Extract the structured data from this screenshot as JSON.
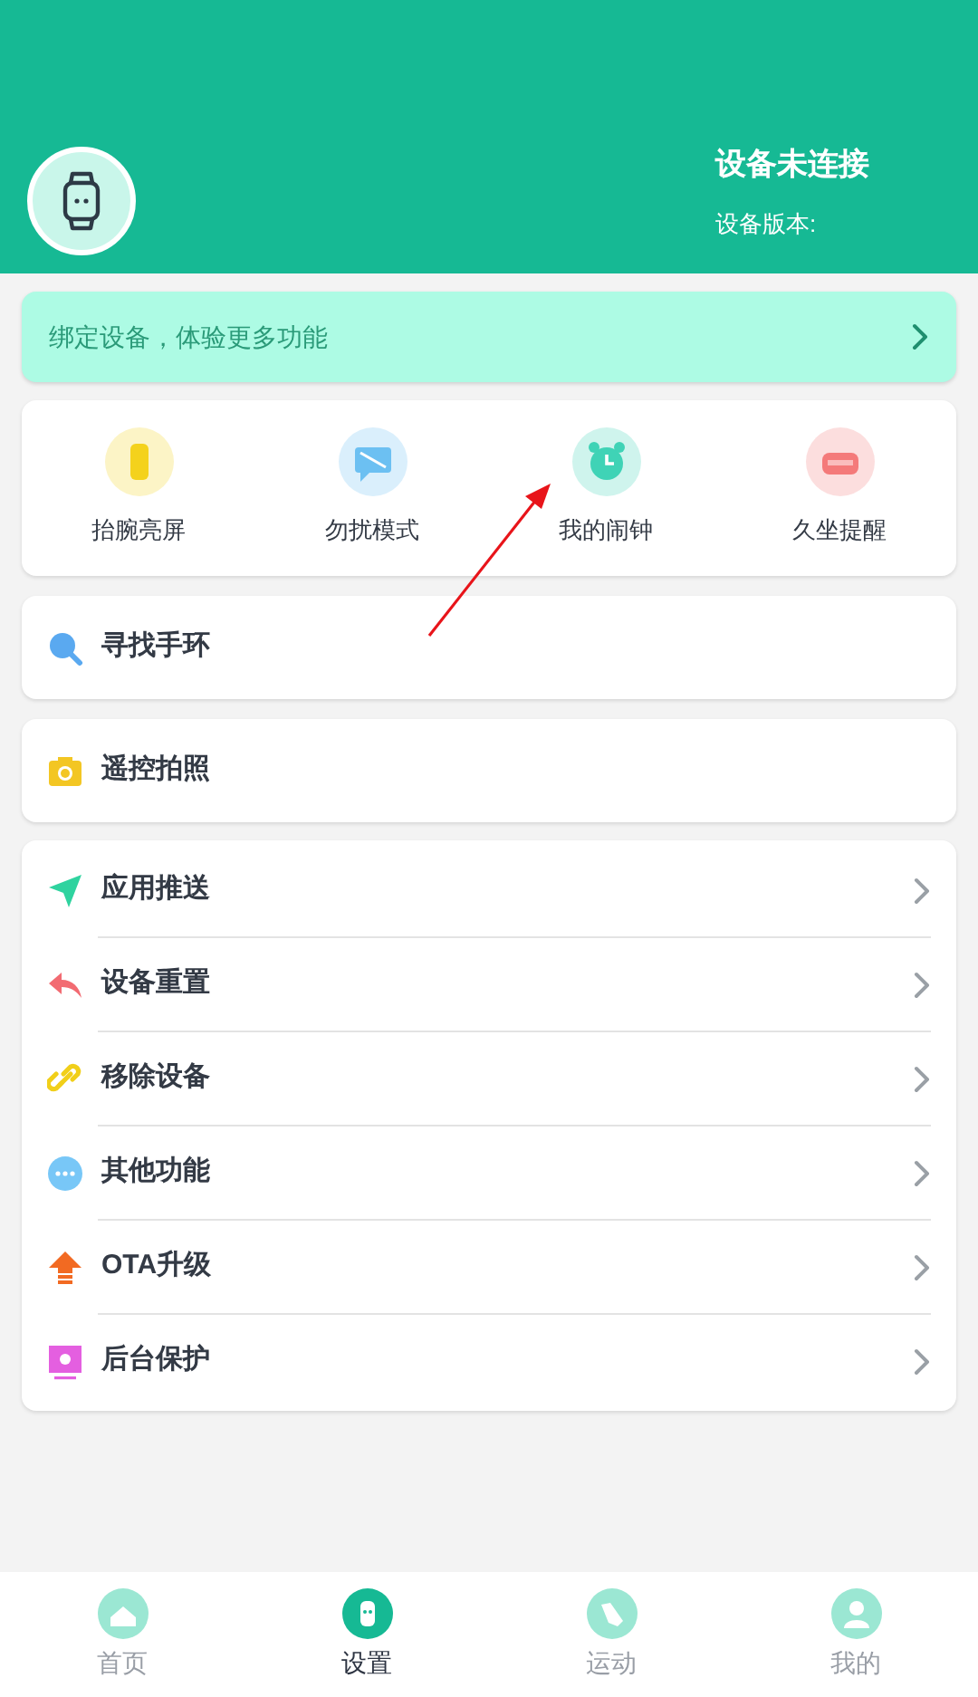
{
  "header": {
    "status": "设备未连接",
    "version_label": "设备版本:"
  },
  "bind_banner": {
    "text": "绑定设备，体验更多功能"
  },
  "quick_actions": [
    {
      "label": "抬腕亮屏",
      "color": "#f4d21c"
    },
    {
      "label": "勿扰模式",
      "color": "#6cc0f2"
    },
    {
      "label": "我的闹钟",
      "color": "#3fd3b6"
    },
    {
      "label": "久坐提醒",
      "color": "#f47a7a"
    }
  ],
  "single_items": [
    {
      "label": "寻找手环"
    },
    {
      "label": "遥控拍照"
    }
  ],
  "menu_items": [
    {
      "label": "应用推送"
    },
    {
      "label": "设备重置"
    },
    {
      "label": "移除设备"
    },
    {
      "label": "其他功能"
    },
    {
      "label": "OTA升级"
    },
    {
      "label": "后台保护"
    }
  ],
  "bottom_nav": [
    {
      "label": "首页",
      "selected": false
    },
    {
      "label": "设置",
      "selected": true
    },
    {
      "label": "运动",
      "selected": false
    },
    {
      "label": "我的",
      "selected": false
    }
  ]
}
